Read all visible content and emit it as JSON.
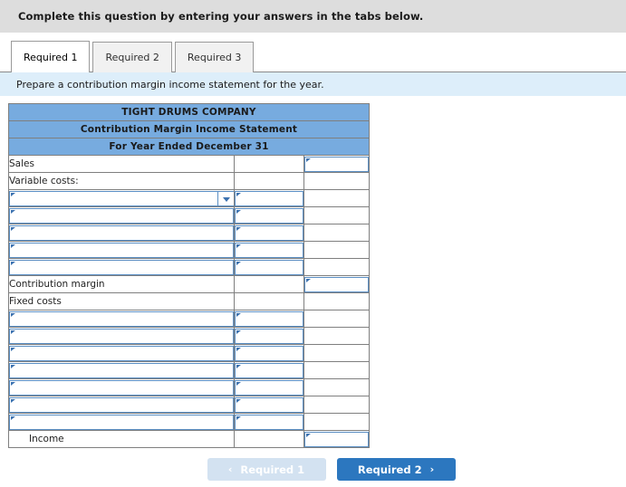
{
  "header": {
    "instruction": "Complete this question by entering your answers in the tabs below."
  },
  "tabs": [
    {
      "label": "Required 1",
      "active": true
    },
    {
      "label": "Required 2",
      "active": false
    },
    {
      "label": "Required 3",
      "active": false
    }
  ],
  "requirement": {
    "text": "Prepare a contribution margin income statement for the year."
  },
  "statement": {
    "title_lines": [
      "TIGHT DRUMS COMPANY",
      "Contribution Margin Income Statement",
      "For Year Ended December 31"
    ],
    "rows": [
      {
        "kind": "label",
        "label": "Sales",
        "indent": false,
        "mid": "blank",
        "right": "input"
      },
      {
        "kind": "label",
        "label": "Variable costs:",
        "indent": false,
        "mid": "blank",
        "right": "blank"
      },
      {
        "kind": "entry",
        "label": "",
        "select": true,
        "mid": "input",
        "right": "blank"
      },
      {
        "kind": "entry",
        "label": "",
        "select": false,
        "mid": "input",
        "right": "blank"
      },
      {
        "kind": "entry",
        "label": "",
        "select": false,
        "mid": "input",
        "right": "blank"
      },
      {
        "kind": "entry",
        "label": "",
        "select": false,
        "mid": "input",
        "right": "blank"
      },
      {
        "kind": "entry",
        "label": "",
        "select": false,
        "mid": "input",
        "right": "blank"
      },
      {
        "kind": "label",
        "label": "Contribution margin",
        "indent": false,
        "mid": "blank",
        "right": "input"
      },
      {
        "kind": "label",
        "label": "Fixed costs",
        "indent": false,
        "mid": "blank",
        "right": "blank"
      },
      {
        "kind": "entry",
        "label": "",
        "select": false,
        "mid": "input",
        "right": "blank"
      },
      {
        "kind": "entry",
        "label": "",
        "select": false,
        "mid": "input",
        "right": "blank"
      },
      {
        "kind": "entry",
        "label": "",
        "select": false,
        "mid": "input",
        "right": "blank"
      },
      {
        "kind": "entry",
        "label": "",
        "select": false,
        "mid": "input",
        "right": "blank"
      },
      {
        "kind": "entry",
        "label": "",
        "select": false,
        "mid": "input",
        "right": "blank"
      },
      {
        "kind": "entry",
        "label": "",
        "select": false,
        "mid": "input",
        "right": "blank"
      },
      {
        "kind": "entry",
        "label": "",
        "select": false,
        "mid": "input",
        "right": "blank"
      },
      {
        "kind": "total",
        "label": "Income",
        "indent": true,
        "mid": "blank",
        "right": "input"
      }
    ]
  },
  "nav": {
    "prev_label": "Required 1",
    "prev_icon": "chevron-left-icon",
    "prev_glyph": "‹",
    "next_label": "Required 2",
    "next_icon": "chevron-right-icon",
    "next_glyph": "›"
  },
  "colors": {
    "header_band": "#dddddd",
    "requirement_band": "#ddeefa",
    "table_header_blue": "#77abdf",
    "input_border_blue": "#5b8fc4",
    "next_button_blue": "#2c77bf",
    "prev_button_blue": "#d3e2f1"
  }
}
